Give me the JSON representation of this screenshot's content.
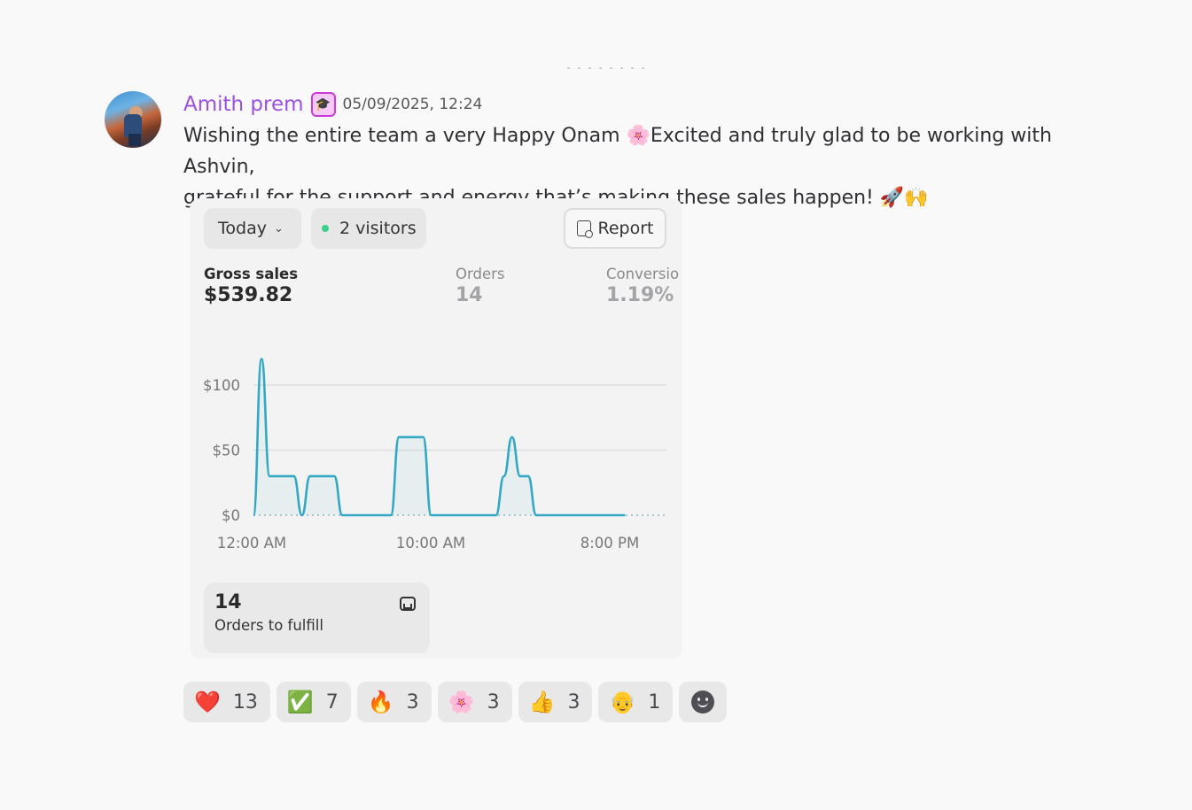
{
  "message": {
    "username": "Amith prem",
    "timestamp": "05/09/2025, 12:24",
    "text_line1": "Wishing the entire team a very Happy Onam ",
    "emoji_flower": "🌸",
    "text_line1b": "Excited and truly glad to be working with Ashvin,",
    "text_line2": "grateful for the support and energy that’s making these sales happen! ",
    "emoji_end": "🚀🙌"
  },
  "card": {
    "date_filter": "Today",
    "visitors": "2 visitors",
    "report_label": "Report",
    "metrics": [
      {
        "label": "Gross sales",
        "value": "$539.82"
      },
      {
        "label": "Orders",
        "value": "14"
      },
      {
        "label": "Conversio",
        "value": "1.19%"
      }
    ],
    "fulfill": {
      "count": "14",
      "label": "Orders to fulfill"
    }
  },
  "chart_data": {
    "type": "line",
    "y_ticks": [
      "$100",
      "$50",
      "$0"
    ],
    "x_ticks": [
      "12:00 AM",
      "10:00 AM",
      "8:00 PM"
    ],
    "ylim": [
      0,
      120
    ],
    "grid": true,
    "color": "#33a8c4",
    "series": [
      {
        "x": [
          0,
          0.5,
          1,
          1.5,
          2,
          2.5,
          3,
          3.5,
          4,
          4.5,
          5,
          5.5,
          6,
          6.5,
          7,
          7.5,
          8,
          8.5,
          9,
          9.5,
          10,
          10.5,
          11,
          11.5,
          12,
          12.5,
          13,
          13.5,
          14,
          14.5,
          15,
          15.5,
          16,
          16.5,
          17,
          17.5,
          18,
          18.5,
          19,
          19.5,
          20,
          20.5,
          21,
          21.5,
          22,
          22.5,
          23
        ],
        "values": [
          0,
          120,
          30,
          30,
          30,
          30,
          0,
          30,
          30,
          30,
          30,
          0,
          0,
          0,
          0,
          0,
          0,
          0,
          60,
          60,
          60,
          60,
          0,
          0,
          0,
          0,
          0,
          0,
          0,
          0,
          0,
          30,
          60,
          30,
          30,
          0,
          0,
          0,
          0,
          0,
          0,
          0,
          0,
          0,
          0,
          0,
          0
        ]
      }
    ]
  },
  "reactions": [
    {
      "emoji": "❤️",
      "count": "13"
    },
    {
      "emoji": "✅",
      "count": "7"
    },
    {
      "emoji": "🔥",
      "count": "3"
    },
    {
      "emoji": "🌸",
      "count": "3"
    },
    {
      "emoji": "👍",
      "count": "3"
    },
    {
      "emoji": "👴",
      "count": "1"
    }
  ]
}
